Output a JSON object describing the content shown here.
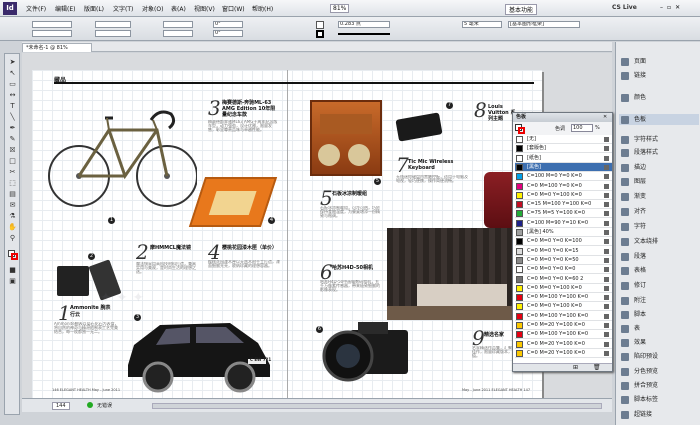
{
  "app": {
    "logo": "Id",
    "workspace": "基本功能",
    "cs_live": "CS Live"
  },
  "menu": [
    "文件(F)",
    "编辑(E)",
    "版面(L)",
    "文字(T)",
    "对象(O)",
    "表(A)",
    "视图(V)",
    "窗口(W)",
    "帮助(H)"
  ],
  "zoom": "81%",
  "controls": {
    "stroke_weight": "0.283 点",
    "offset": "5 毫米",
    "style": "[基本图形框架]",
    "angle": "0°"
  },
  "doc_tab": "*未命名-1 @ 81%",
  "spread": {
    "section": "藏品",
    "items": [
      {
        "num": "1",
        "title": "Ammonite 腕表",
        "subtitle": "行云"
      },
      {
        "num": "2",
        "title": "摩HMMCL魔法镜"
      },
      {
        "num": "3",
        "title": "梅赛德斯-奔驰ML-63 AMG Edition 10年限量纪念车款"
      },
      {
        "num": "4",
        "title": "樱桃花园漆木匣（单价）"
      },
      {
        "num": "5",
        "title": "石板冰凉制暖组"
      },
      {
        "num": "6",
        "title": "哈苏H4D-50相机"
      },
      {
        "num": "7",
        "title": "Tic Mic Wireless Keyboard"
      },
      {
        "num": "8",
        "title": "Louis Vuitton 系列主题"
      },
      {
        "num": "9",
        "title": "精选名家"
      }
    ],
    "folio_left": "146 ELEGANT HEALTH  May - June 2011",
    "folio_right": "May - June 2011 ELEGANT HEALTH 147",
    "plate": "C EW 721"
  },
  "status": {
    "page": "144",
    "state": "无错误"
  },
  "dock": [
    "页面",
    "链接",
    "颜色",
    "色板",
    "字符样式",
    "段落样式",
    "描边",
    "图层",
    "渐变",
    "对齐",
    "字符",
    "文本绕排",
    "段落",
    "表格",
    "修订",
    "附注",
    "脚本",
    "表",
    "效果",
    "陷印预设",
    "分色预览",
    "拼合预览",
    "脚本标签",
    "超链接"
  ],
  "swatches": {
    "title": "色板",
    "tint_label": "色调",
    "tint": "100",
    "pct": "%",
    "items": [
      {
        "name": "[无]",
        "color": "#ffffff"
      },
      {
        "name": "[套版色]",
        "color": "#000000"
      },
      {
        "name": "[纸色]",
        "color": "#ffffff"
      },
      {
        "name": "[黑色]",
        "color": "#000000"
      },
      {
        "name": "C=100 M=0 Y=0 K=0",
        "color": "#00a0e9"
      },
      {
        "name": "C=0 M=100 Y=0 K=0",
        "color": "#e4007f"
      },
      {
        "name": "C=0 M=0 Y=100 K=0",
        "color": "#fff100"
      },
      {
        "name": "C=15 M=100 Y=100 K=0",
        "color": "#c30d23"
      },
      {
        "name": "C=75 M=5 Y=100 K=0",
        "color": "#22ac38"
      },
      {
        "name": "C=100 M=90 Y=10 K=0",
        "color": "#1d2088"
      },
      {
        "name": "[黑色] 40%",
        "color": "#9fa0a0"
      },
      {
        "name": "C=0 M=0 Y=0 K=100",
        "color": "#000000"
      },
      {
        "name": "C=0 M=0 Y=0 K=15",
        "color": "#dcdddd"
      },
      {
        "name": "C=0 M=0 Y=0 K=50",
        "color": "#898989"
      },
      {
        "name": "C=0 M=0 Y=0 K=0",
        "color": "#ffffff"
      },
      {
        "name": "C=0 M=0 Y=0 K=60 2",
        "color": "#727171"
      },
      {
        "name": "C=0 M=0 Y=100 K=0",
        "color": "#fff100"
      },
      {
        "name": "C=0 M=100 Y=100 K=0",
        "color": "#e60012"
      },
      {
        "name": "C=0 M=0 Y=100 K=0",
        "color": "#fff100"
      },
      {
        "name": "C=0 M=100 Y=100 K=0",
        "color": "#e60012"
      },
      {
        "name": "C=0 M=20 Y=100 K=0",
        "color": "#fcc800"
      },
      {
        "name": "C=0 M=100 Y=100 K=0",
        "color": "#e60012"
      },
      {
        "name": "C=0 M=20 Y=100 K=0",
        "color": "#fcc800"
      },
      {
        "name": "C=0 M=20 Y=100 K=0",
        "color": "#fcc800"
      }
    ]
  }
}
